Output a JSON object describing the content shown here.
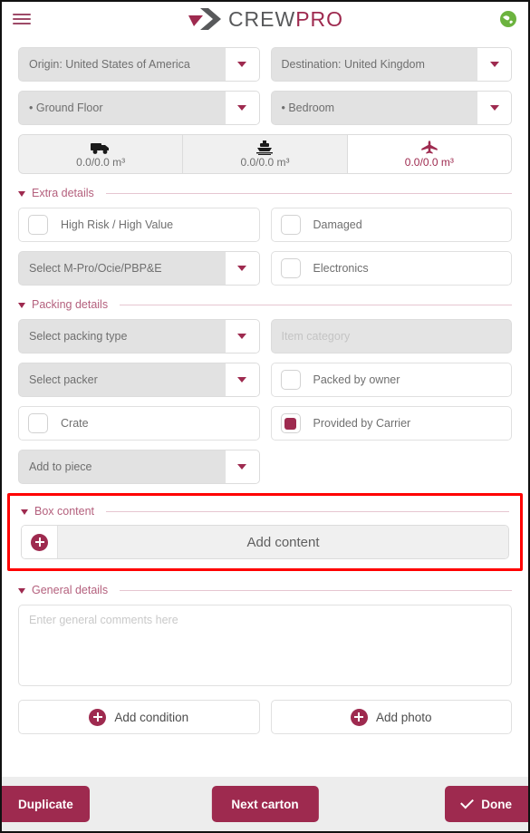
{
  "header": {
    "menu_icon": "hamburger-menu-icon",
    "logo_crew": "CREW",
    "logo_pro": "PRO",
    "globe_icon": "globe-icon",
    "brand_color": "#9e2a4f",
    "logo_gray": "#58595b",
    "globe_color": "#6cb33f"
  },
  "location": {
    "origin": "Origin: United States of America",
    "destination": "Destination: United Kingdom",
    "floor": "• Ground Floor",
    "room": "• Bedroom"
  },
  "modes": [
    {
      "icon": "truck-icon",
      "volume": "0.0/0.0 m³",
      "active": false
    },
    {
      "icon": "ship-icon",
      "volume": "0.0/0.0 m³",
      "active": false
    },
    {
      "icon": "plane-icon",
      "volume": "0.0/0.0 m³",
      "active": true
    }
  ],
  "extra_details": {
    "title": "Extra details",
    "high_risk_label": "High Risk / High Value",
    "high_risk_checked": false,
    "damaged_label": "Damaged",
    "damaged_checked": false,
    "mpro_select": "Select M-Pro/Ocie/PBP&E",
    "electronics_label": "Electronics",
    "electronics_checked": false
  },
  "packing_details": {
    "title": "Packing details",
    "packing_type": "Select packing type",
    "item_category_placeholder": "Item category",
    "packer": "Select packer",
    "packed_by_owner_label": "Packed by owner",
    "packed_by_owner_checked": false,
    "crate_label": "Crate",
    "crate_checked": false,
    "provided_by_carrier_label": "Provided by Carrier",
    "provided_by_carrier_checked": true,
    "add_to_piece": "Add to piece"
  },
  "box_content": {
    "title": "Box content",
    "add_content_label": "Add content",
    "add_icon": "plus-circle-icon",
    "highlight_color": "#ff0000"
  },
  "general_details": {
    "title": "General details",
    "comments_placeholder": "Enter general comments here",
    "comments_value": "",
    "add_condition_label": "Add condition",
    "add_photo_label": "Add photo"
  },
  "footer": {
    "duplicate_label": "Duplicate",
    "next_carton_label": "Next carton",
    "done_label": "Done",
    "done_icon": "check-icon"
  }
}
